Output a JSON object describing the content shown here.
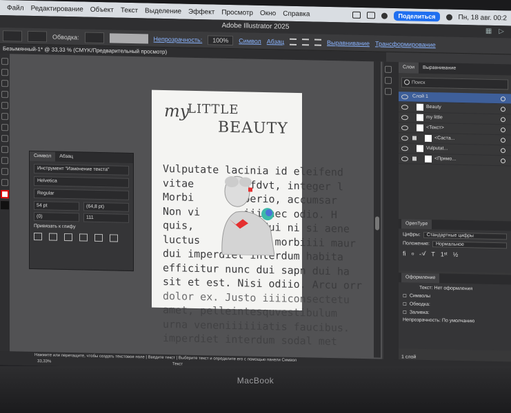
{
  "menubar": {
    "items": [
      "Файл",
      "Редактирование",
      "Объект",
      "Текст",
      "Выделение",
      "Эффект",
      "Просмотр",
      "Окно",
      "Справка"
    ],
    "share_label": "Поделиться",
    "clock": "Пн, 18 авг. 00:2"
  },
  "window": {
    "title": "Adobe Illustrator 2025"
  },
  "control": {
    "stroke_label": "Обводка:",
    "opacity_label": "Непрозрачность:",
    "opacity_value": "100%",
    "symbol_label": "Символ",
    "paragraph_label": "Абзац",
    "align_label": "Выравнивание",
    "transform_label": "Трансформирование"
  },
  "document_tab": "Безымянный-1* @ 33,33 % (CMYK/Предварительный просмотр)",
  "artboard": {
    "logo_my": "my",
    "logo_little": "LITTLE",
    "logo_beauty": "BEAUTY",
    "body_lines": [
      "Vulputate lacinia id eleifend",
      "vitae      amefdvt, integer l",
      "Morbi      liberio, accumsar",
      "Non vi       iii nec odio. H",
      "quis,           dui ni si aene",
      "luctus          e morbiiii maur",
      "dui imperdiet interdum habita",
      "efficitur nunc dui sapn dui ha",
      "sit et est. Nisi odiio. Arcu orr"
    ],
    "overflow_lines": [
      "dolor ex. Justo iiiiconsectetu",
      "amet, pelleintesquvestibulum",
      "urna veneniiiiiiatis faucibus.",
      "imperdiet interdum sodal met"
    ]
  },
  "char_panel": {
    "tabs": [
      "Символ",
      "Абзац"
    ],
    "tool_label": "Инструмент \"Изменение текста\"",
    "font": "Helvetica",
    "style": "Regular",
    "size": "54 pt",
    "leading": "(64,8 pt)",
    "kern": "(0)",
    "tracking": "111",
    "snap_label": "Привязать к глифу"
  },
  "layers_panel": {
    "tabs": [
      "Слои",
      "Выравнивание"
    ],
    "search_placeholder": "Поиск",
    "layers": [
      {
        "name": "Слой 1",
        "selected": true
      },
      {
        "name": "Beauty"
      },
      {
        "name": "my little"
      },
      {
        "name": "<Текст>"
      },
      {
        "name": "<Састa..."
      },
      {
        "name": "Vulputat..."
      },
      {
        "name": "<Прямо..."
      }
    ],
    "footer": "1 слой"
  },
  "opentype_panel": {
    "tab": "OpenType",
    "digits_label": "Цифры:",
    "digits_value": "Стандартные цифры",
    "position_label": "Положение:",
    "position_value": "Нормальное"
  },
  "appearance_panel": {
    "tab": "Оформление",
    "text_label": "Текст: Нет оформления",
    "symbols_label": "Символы",
    "stroke_label": "Обводка:",
    "fill_label": "Заливка:",
    "opacity_label": "Непрозрачность: По умолчанию"
  },
  "statusbar": {
    "hint": "Нажмите или перетащите, чтобы создать текстовое поле | Введите текст | Выберите текст и определите его с помощью панели Символ",
    "zoom": "33,33%",
    "mode": "Текст"
  },
  "laptop_label": "MacBook"
}
